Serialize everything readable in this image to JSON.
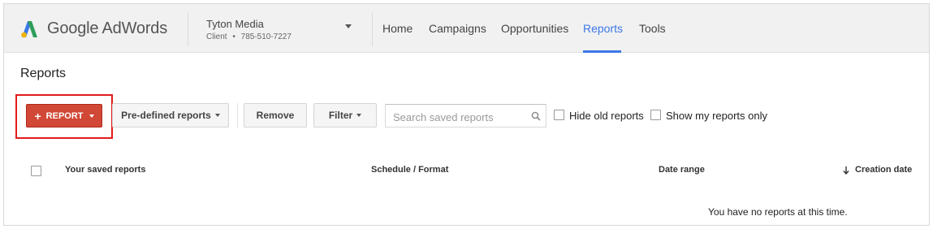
{
  "header": {
    "brand": "Google AdWords",
    "account": {
      "name": "Tyton Media",
      "role": "Client",
      "separator": "•",
      "id": "785-510-7227"
    },
    "nav": [
      {
        "label": "Home"
      },
      {
        "label": "Campaigns"
      },
      {
        "label": "Opportunities"
      },
      {
        "label": "Reports",
        "active": true
      },
      {
        "label": "Tools"
      }
    ],
    "accent_color": "#3b78e7"
  },
  "page": {
    "title": "Reports"
  },
  "toolbar": {
    "report_button": "REPORT",
    "report_button_color": "#d14836",
    "predefined_button": "Pre-defined reports",
    "remove_button": "Remove",
    "filter_button": "Filter",
    "search_placeholder": "Search saved reports",
    "hide_old_label": "Hide old reports",
    "hide_old_checked": false,
    "show_mine_label": "Show my reports only",
    "show_mine_checked": false
  },
  "table": {
    "columns": [
      "Your saved reports",
      "Schedule / Format",
      "Date range",
      "Creation date"
    ],
    "sort_column": "Creation date",
    "sort_direction": "descending",
    "select_all_checked": false,
    "empty_message": "You have no reports at this time."
  }
}
